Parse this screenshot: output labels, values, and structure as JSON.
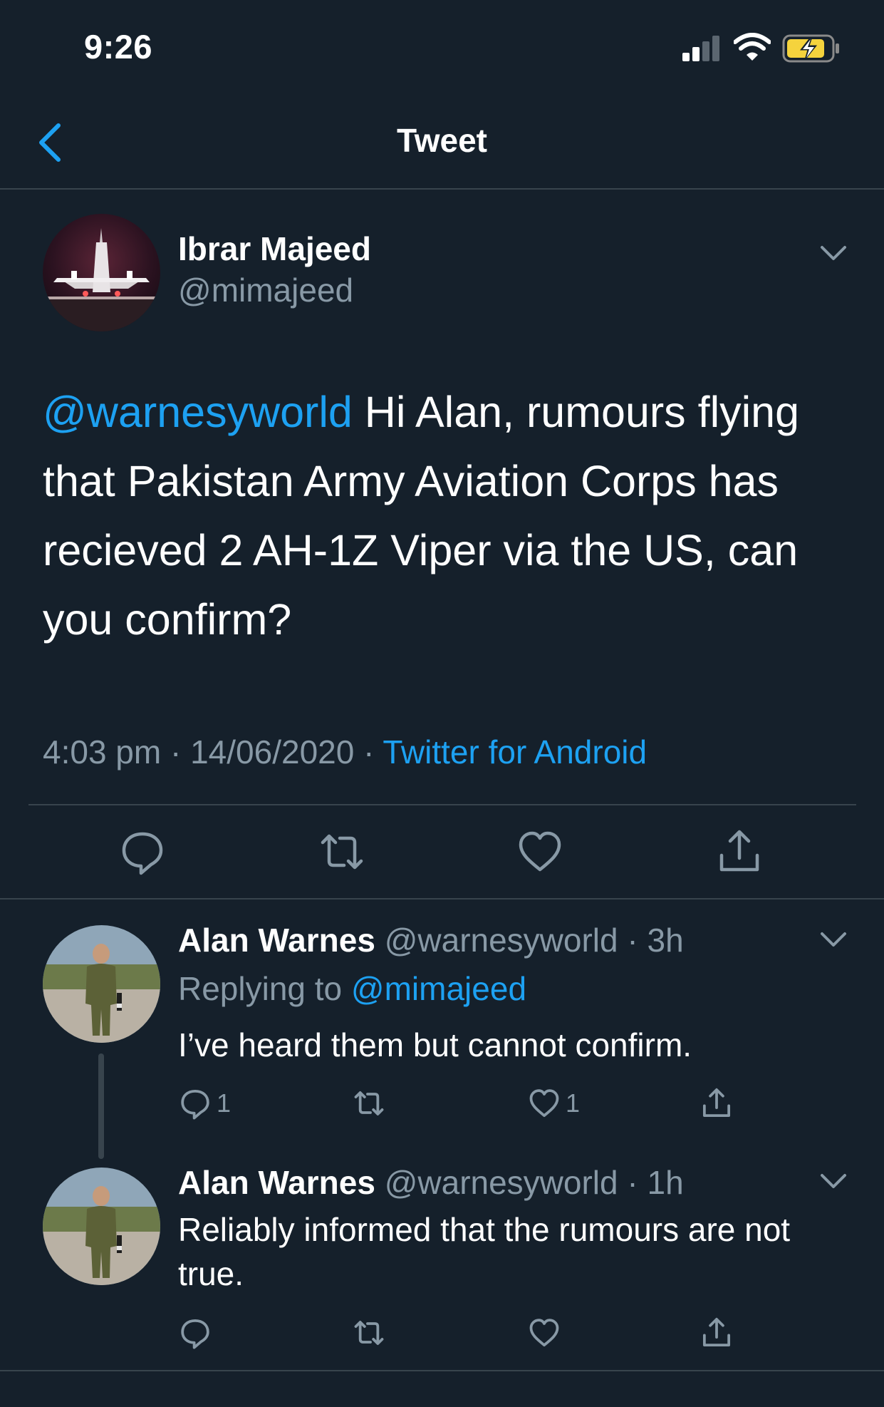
{
  "status_bar": {
    "time": "9:26",
    "icons": [
      "signal-icon",
      "wifi-icon",
      "battery-charging-icon"
    ]
  },
  "nav": {
    "title": "Tweet",
    "back_icon": "chevron-left-icon"
  },
  "tweet": {
    "author_name": "Ibrar Majeed",
    "author_handle": "@mimajeed",
    "mention": "@warnesyworld",
    "text": " Hi Alan, rumours flying that Pakistan Army Aviation Corps has recieved 2 AH-1Z Viper via the US, can you confirm?",
    "timestamp": "4:03 pm · 14/06/2020 · ",
    "source": "Twitter for Android",
    "actions": [
      "reply-icon",
      "retweet-icon",
      "like-icon",
      "share-icon"
    ]
  },
  "replies": [
    {
      "author_name": "Alan Warnes",
      "author_handle": "@warnesyworld",
      "age": " · 3h",
      "replying_prefix": "Replying to ",
      "replying_to": "@mimajeed",
      "text": "I’ve heard them but cannot confirm.",
      "reply_count": "1",
      "like_count": "1"
    },
    {
      "author_name": "Alan Warnes",
      "author_handle": "@warnesyworld",
      "age": " · 1h",
      "text": "Reliably informed that the rumours are not true."
    }
  ],
  "colors": {
    "background": "#15202b",
    "accent": "#1da1f2",
    "secondary_text": "#8899a6",
    "divider": "#38444d",
    "battery": "#f5d33d"
  }
}
